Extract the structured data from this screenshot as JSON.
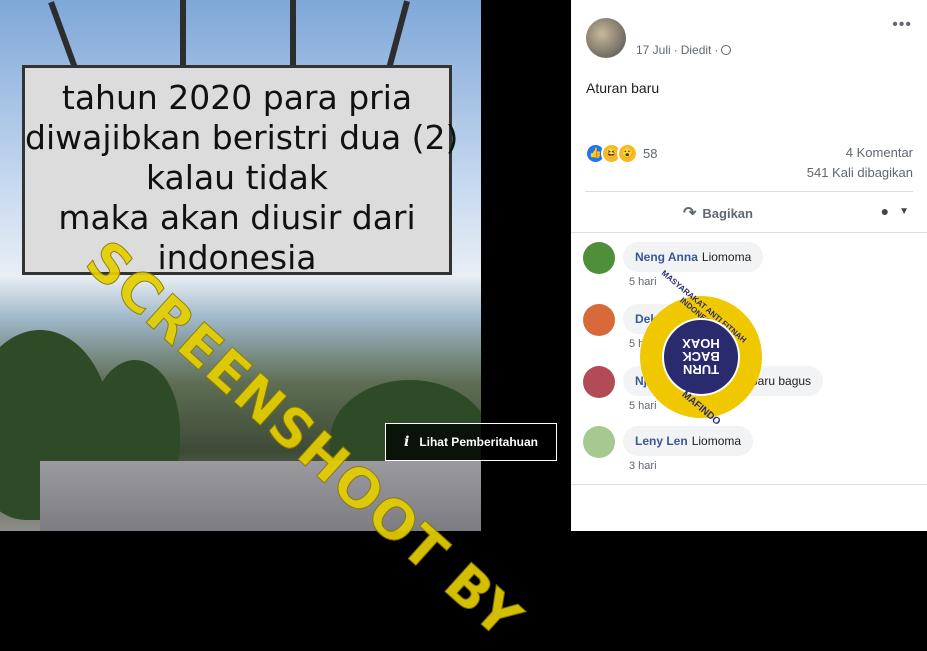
{
  "photo": {
    "sign_lines": [
      "tahun 2020 para pria",
      "diwajibkan beristri dua (2)",
      "kalau tidak",
      "maka akan diusir dari",
      "indonesia"
    ],
    "watermark": "SCREENSHOOT BY",
    "notice_label": "Lihat Pemberitahuan"
  },
  "post": {
    "date": "17 Juli",
    "edited": "Diedit",
    "text": "Aturan baru",
    "reaction_count": "58",
    "comments": "4 Komentar",
    "shares": "541 Kali dibagikan",
    "share_label": "Bagikan"
  },
  "comments": [
    {
      "name": "Neng Anna",
      "text": "Liomoma",
      "time": "5 hari",
      "avatar_color": "#4f8f3a"
    },
    {
      "name": "Dek F",
      "text": "",
      "time": "5 hari",
      "avatar_color": "#d8693b"
    },
    {
      "name": "Nj",
      "text": "baru bagus",
      "time": "5 hari",
      "avatar_color": "#b34b56"
    },
    {
      "name": "Leny Len",
      "text": "Liomoma",
      "time": "3 hari",
      "avatar_color": "#a5c98e"
    }
  ],
  "badge": {
    "top_text": "MASYARAKAT ANTI FITNAH INDONESIA",
    "center_text": "TURN BACK HOAX",
    "bottom_text": "MAFINDO"
  },
  "colors": {
    "link": "#385898",
    "like": "#1877f2",
    "watermark": "#e5cf00"
  }
}
